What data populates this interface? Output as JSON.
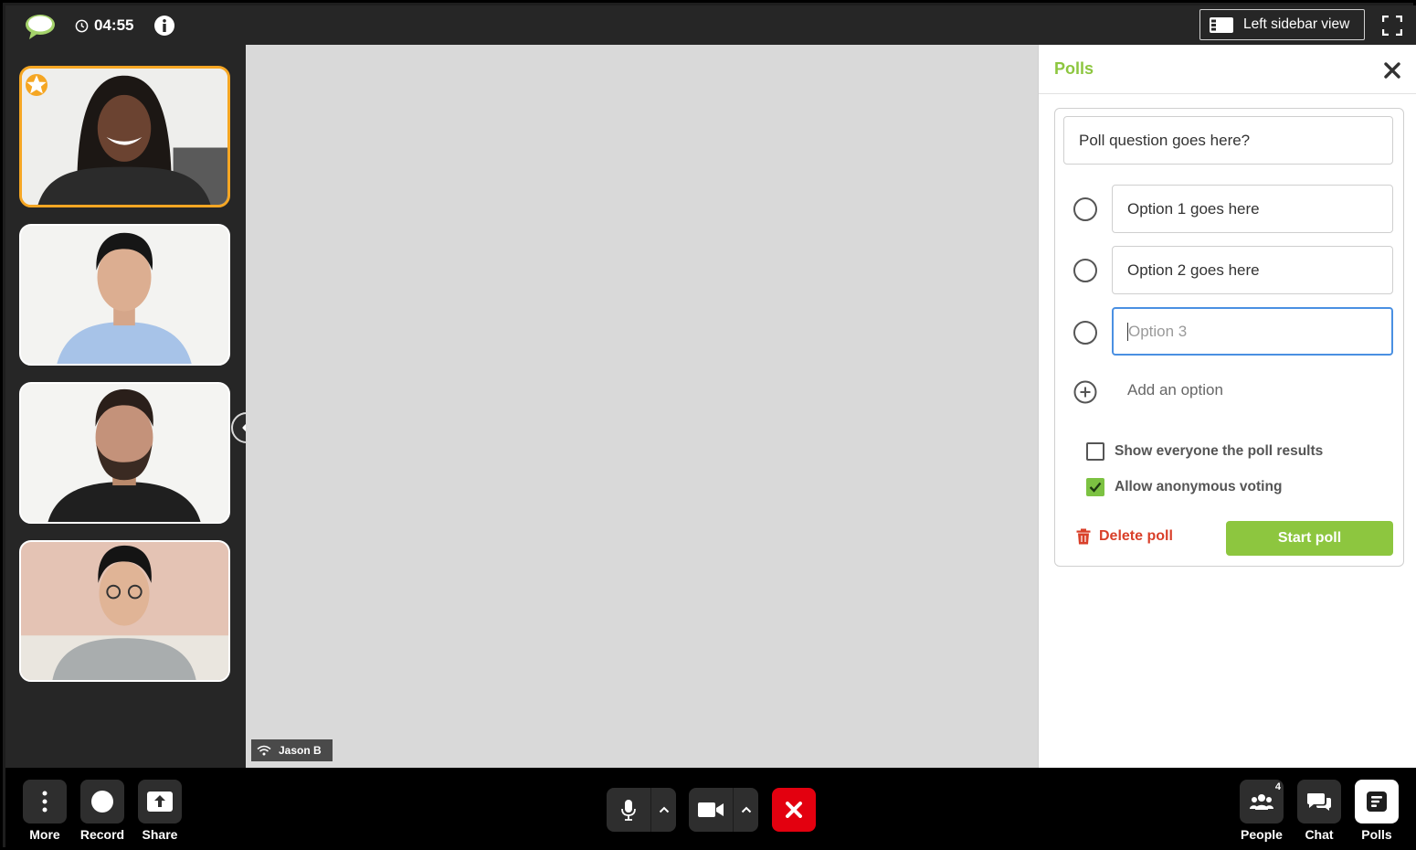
{
  "topbar": {
    "timer": "04:55",
    "view_button_label": "Left sidebar view"
  },
  "stage": {
    "speaker_name": "Jason B"
  },
  "polls_panel": {
    "title": "Polls",
    "question_value": "Poll question goes here?",
    "options": [
      {
        "value": "Option 1 goes here",
        "placeholder": ""
      },
      {
        "value": "Option 2 goes here",
        "placeholder": ""
      },
      {
        "value": "",
        "placeholder": "Option 3"
      }
    ],
    "add_option_label": "Add an option",
    "show_results_label": "Show everyone the poll results",
    "show_results_checked": false,
    "anonymous_label": "Allow anonymous voting",
    "anonymous_checked": true,
    "delete_label": "Delete poll",
    "start_label": "Start poll"
  },
  "bottombar": {
    "more_label": "More",
    "record_label": "Record",
    "share_label": "Share",
    "people_label": "People",
    "people_count": "4",
    "chat_label": "Chat",
    "polls_label": "Polls"
  },
  "colors": {
    "accent_green": "#8dc63f",
    "host_orange": "#f5a623",
    "end_red": "#e3000f",
    "delete_red": "#d9402a",
    "focus_blue": "#4a90e2"
  },
  "icons": [
    "chat-logo-icon",
    "clock-icon",
    "info-icon",
    "sidebar-layout-icon",
    "fullscreen-icon",
    "star-icon",
    "chevron-left-icon",
    "wifi-icon",
    "close-icon",
    "plus-circle-icon",
    "check-icon",
    "trash-icon",
    "more-vertical-icon",
    "record-icon",
    "share-upload-icon",
    "microphone-icon",
    "chevron-up-icon",
    "video-camera-icon",
    "end-call-icon",
    "people-icon",
    "chat-icon",
    "polls-icon"
  ]
}
